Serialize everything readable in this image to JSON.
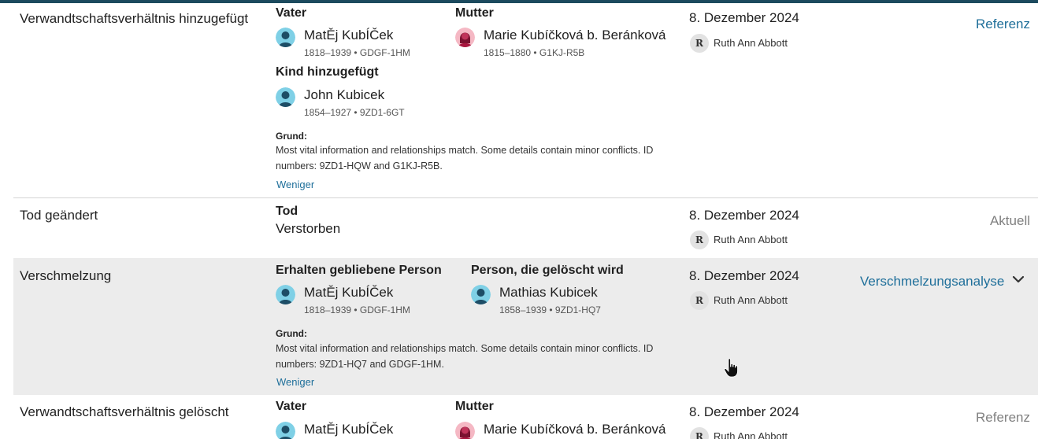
{
  "entries": [
    {
      "type": "Verwandtschaftsverhältnis hinzugefügt",
      "father_label": "Vater",
      "father": {
        "name": "MatĚj KubÍČek",
        "meta": "1818–1939 • GDGF-1HM"
      },
      "mother_label": "Mutter",
      "mother": {
        "name": "Marie Kubíčková b. Beránková",
        "meta": "1815–1880 • G1KJ-R5B"
      },
      "child_label": "Kind hinzugefügt",
      "child": {
        "name": "John Kubicek",
        "meta": "1854–1927 • 9ZD1-6GT"
      },
      "reason_label": "Grund:",
      "reason": "Most vital information and relationships match. Some details contain minor conflicts. ID numbers: 9ZD1-HQW and G1KJ-R5B.",
      "less": "Weniger",
      "date": "8. Dezember 2024",
      "contributor_initial": "R",
      "contributor": "Ruth Ann Abbott",
      "action": "Referenz"
    },
    {
      "type": "Tod geändert",
      "field_label": "Tod",
      "field_value": "Verstorben",
      "date": "8. Dezember 2024",
      "contributor_initial": "R",
      "contributor": "Ruth Ann Abbott",
      "action": "Aktuell"
    },
    {
      "type": "Verschmelzung",
      "kept_label": "Erhalten gebliebene Person",
      "kept": {
        "name": "MatĚj KubÍČek",
        "meta": "1818–1939 • GDGF-1HM"
      },
      "deleted_label": "Person, die gelöscht wird",
      "deleted": {
        "name": "Mathias Kubicek",
        "meta": "1858–1939 • 9ZD1-HQ7"
      },
      "reason_label": "Grund:",
      "reason": "Most vital information and relationships match. Some details contain minor conflicts. ID numbers: 9ZD1-HQ7 and GDGF-1HM.",
      "less": "Weniger",
      "date": "8. Dezember 2024",
      "contributor_initial": "R",
      "contributor": "Ruth Ann Abbott",
      "action": "Verschmelzungsanalyse"
    },
    {
      "type": "Verwandtschaftsverhältnis gelöscht",
      "father_label": "Vater",
      "father": {
        "name": "MatĚj KubÍČek"
      },
      "mother_label": "Mutter",
      "mother": {
        "name": "Marie Kubíčková b. Beránková"
      },
      "date": "8. Dezember 2024",
      "contributor_initial": "R",
      "contributor": "Ruth Ann Abbott",
      "action": "Referenz"
    }
  ],
  "colors": {
    "accent_link": "#1f6f9a",
    "male_avatar_bg": "#7fd0e6",
    "female_avatar_bg": "#f5b8c4",
    "shaded_row": "#ececec",
    "top_bar": "#1c4a5e"
  },
  "icons": {
    "male": "male-avatar-icon",
    "female": "female-avatar-icon",
    "expand": "chevron-down-icon",
    "cursor": "hand-pointer-cursor"
  }
}
